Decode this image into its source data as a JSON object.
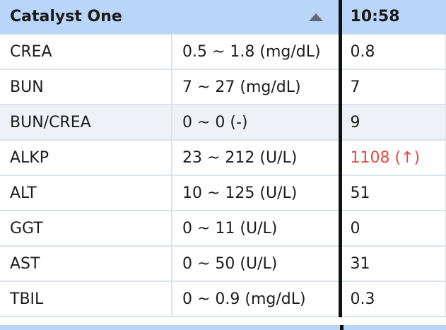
{
  "header": {
    "title": "Catalyst One",
    "time": "10:58"
  },
  "rows": [
    {
      "test": "CREA",
      "range": "0.5 ~ 1.8 (mg/dL)",
      "result": "0.8",
      "abnormal": false,
      "shaded": false
    },
    {
      "test": "BUN",
      "range": "7 ~ 27 (mg/dL)",
      "result": "7",
      "abnormal": false,
      "shaded": false
    },
    {
      "test": "BUN/CREA",
      "range": "0 ~ 0 (-)",
      "result": "9",
      "abnormal": false,
      "shaded": true
    },
    {
      "test": "ALKP",
      "range": "23 ~ 212 (U/L)",
      "result": "1108 (↑)",
      "abnormal": true,
      "shaded": false
    },
    {
      "test": "ALT",
      "range": "10 ~ 125 (U/L)",
      "result": "51",
      "abnormal": false,
      "shaded": false
    },
    {
      "test": "GGT",
      "range": "0 ~ 11 (U/L)",
      "result": "0",
      "abnormal": false,
      "shaded": false
    },
    {
      "test": "AST",
      "range": "0 ~ 50 (U/L)",
      "result": "31",
      "abnormal": false,
      "shaded": false
    },
    {
      "test": "TBIL",
      "range": "0 ~ 0.9 (mg/dL)",
      "result": "0.3",
      "abnormal": false,
      "shaded": false
    }
  ],
  "colors": {
    "header_bg": "#b9d5f8",
    "abnormal": "#e8473e",
    "shaded_row": "#eef1f6",
    "divider": "#111111"
  }
}
